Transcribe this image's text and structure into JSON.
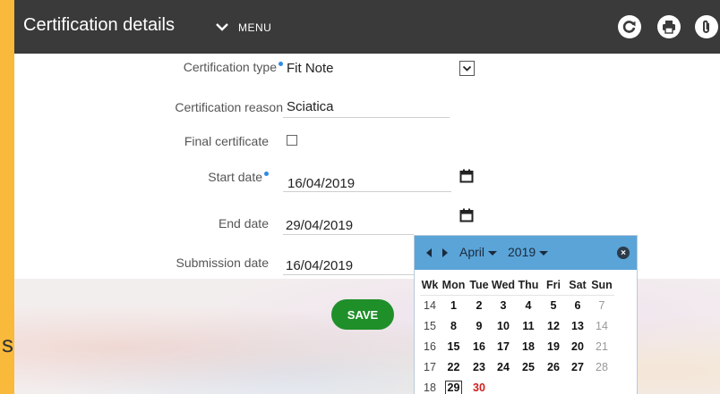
{
  "header": {
    "title": "Certification details",
    "menu_label": "MENU",
    "icons": [
      "refresh-icon",
      "print-icon",
      "attach-icon"
    ]
  },
  "form": {
    "type_label": "Certification type",
    "type_value": "Fit Note",
    "reason_label": "Certification reason",
    "reason_value": "Sciatica",
    "final_label": "Final certificate",
    "final_checked": false,
    "start_label": "Start date",
    "start_value": "16/04/2019",
    "end_label": "End date",
    "end_value": "29/04/2019",
    "submission_label": "Submission date",
    "submission_value": "16/04/2019",
    "required_color": "#2e8be0"
  },
  "save_label": "SAVE",
  "edge_text": "s",
  "datepicker": {
    "month": "April",
    "year": "2019",
    "headers": [
      "Wk",
      "Mon",
      "Tue",
      "Wed",
      "Thu",
      "Fri",
      "Sat",
      "Sun"
    ],
    "rows": [
      [
        "14",
        "1",
        "2",
        "3",
        "4",
        "5",
        "6",
        "7"
      ],
      [
        "15",
        "8",
        "9",
        "10",
        "11",
        "12",
        "13",
        "14"
      ],
      [
        "16",
        "15",
        "16",
        "17",
        "18",
        "19",
        "20",
        "21"
      ],
      [
        "17",
        "22",
        "23",
        "24",
        "25",
        "26",
        "27",
        "28"
      ],
      [
        "18",
        "29",
        "30",
        "",
        "",
        "",
        "",
        ""
      ]
    ],
    "selected": "29",
    "highlight_red": [
      "30"
    ],
    "header_color": "#5aa4d8"
  },
  "colors": {
    "topbar": "#3a3a3a",
    "frame": "#f9b93a",
    "save": "#1f8f2a"
  }
}
